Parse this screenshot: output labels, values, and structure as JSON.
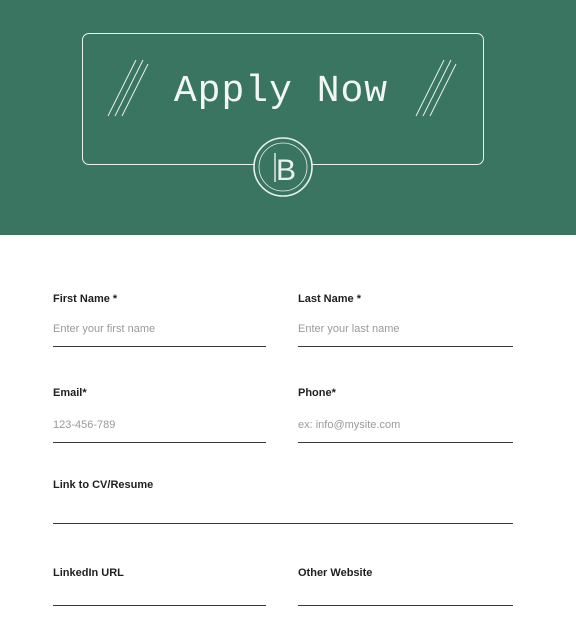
{
  "hero": {
    "title": "Apply Now",
    "logo_letters": "B",
    "colors": {
      "background": "#3a7562",
      "line": "#e9f1ed"
    }
  },
  "form": {
    "first_name": {
      "label": "First Name *",
      "placeholder": "Enter your first name"
    },
    "last_name": {
      "label": "Last Name *",
      "placeholder": "Enter your last name"
    },
    "email": {
      "label": "Email*",
      "placeholder": "123-456-789"
    },
    "phone": {
      "label": "Phone*",
      "placeholder": "ex: info@mysite.com"
    },
    "cv_link": {
      "label": "Link to CV/Resume",
      "placeholder": ""
    },
    "linkedin": {
      "label": "LinkedIn URL",
      "placeholder": ""
    },
    "other_website": {
      "label": "Other Website",
      "placeholder": ""
    }
  }
}
